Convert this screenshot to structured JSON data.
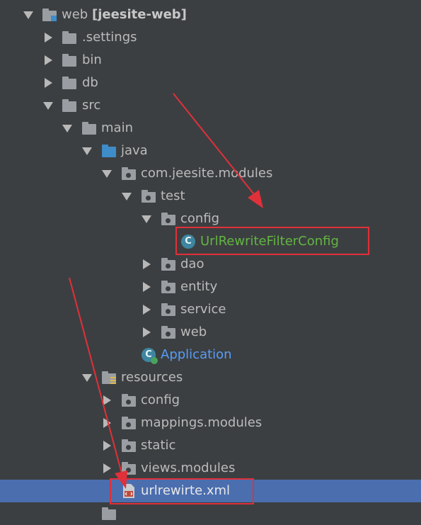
{
  "tree": {
    "root": {
      "name": "web",
      "module": "[jeesite-web]"
    },
    "settings": ".settings",
    "bin": "bin",
    "db": "db",
    "src": "src",
    "main": "main",
    "java": "java",
    "package": "com.jeesite.modules",
    "test": "test",
    "config": "config",
    "filter_class": "UrlRewriteFilterConfig",
    "dao": "dao",
    "entity": "entity",
    "service": "service",
    "web_pkg": "web",
    "application": "Application",
    "resources": "resources",
    "res_config": "config",
    "mappings": "mappings.modules",
    "static": "static",
    "views": "views.modules",
    "xml_file": "urlrewirte.xml"
  },
  "colors": {
    "background": "#3c3f41",
    "selection": "#4b6eaf",
    "class_text": "#62b543",
    "application_text": "#589df6",
    "annotation": "#e0303a"
  }
}
